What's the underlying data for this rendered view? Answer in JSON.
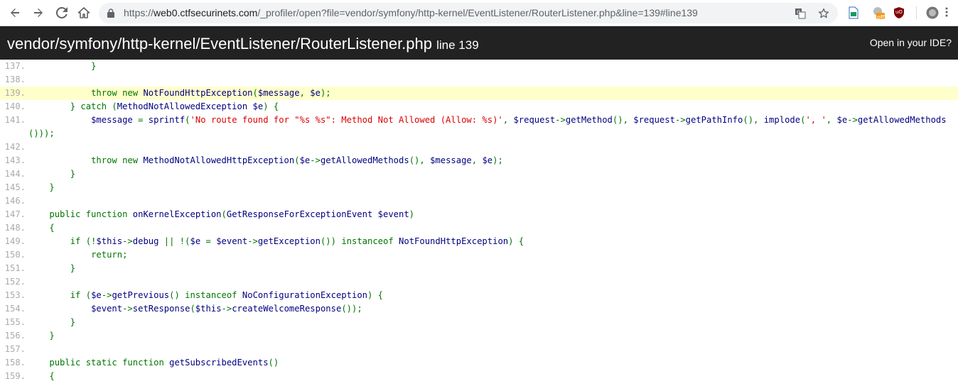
{
  "browser": {
    "url_host": "web0.ctfsecurinets.com",
    "url_scheme": "https://",
    "url_rest": "/_profiler/open?file=vendor/symfony/http-kernel/EventListener/RouterListener.php&line=139#line139",
    "icons": [
      "back-icon",
      "forward-icon",
      "reload-icon",
      "home-icon",
      "lock-icon",
      "translate-icon",
      "star-icon"
    ],
    "extensions": {
      "off_badge": "off",
      "ublock_label": "uO"
    }
  },
  "header": {
    "path": "vendor/symfony/http-kernel/EventListener/RouterListener.php",
    "line_label": "line 139",
    "ide_link": "Open in your IDE?"
  },
  "colors": {
    "highlight": "#ffffcc",
    "keyword": "#007700",
    "string": "#dd0000",
    "default": "#000080"
  },
  "code": {
    "highlight_line": "139.",
    "lines": [
      {
        "num": "137.",
        "tokens": [
          {
            "t": "            }",
            "c": "punct"
          }
        ]
      },
      {
        "num": "138.",
        "tokens": []
      },
      {
        "num": "139.",
        "tokens": [
          {
            "t": "            throw new ",
            "c": "keyword"
          },
          {
            "t": "NotFoundHttpException",
            "c": "default"
          },
          {
            "t": "(",
            "c": "punct"
          },
          {
            "t": "$message",
            "c": "default"
          },
          {
            "t": ", ",
            "c": "punct"
          },
          {
            "t": "$e",
            "c": "default"
          },
          {
            "t": ");",
            "c": "punct"
          }
        ]
      },
      {
        "num": "140.",
        "tokens": [
          {
            "t": "        } catch (",
            "c": "keyword"
          },
          {
            "t": "MethodNotAllowedException $e",
            "c": "default"
          },
          {
            "t": ") {",
            "c": "punct"
          }
        ]
      },
      {
        "num": "141.",
        "wrap": true,
        "tokens": [
          {
            "t": "            ",
            "c": "punct"
          },
          {
            "t": "$message ",
            "c": "default"
          },
          {
            "t": "= ",
            "c": "punct"
          },
          {
            "t": "sprintf",
            "c": "default"
          },
          {
            "t": "(",
            "c": "punct"
          },
          {
            "t": "'No route found for \"%s %s\": Method Not Allowed (Allow: %s)'",
            "c": "string"
          },
          {
            "t": ", ",
            "c": "punct"
          },
          {
            "t": "$request",
            "c": "default"
          },
          {
            "t": "->",
            "c": "punct"
          },
          {
            "t": "getMethod",
            "c": "default"
          },
          {
            "t": "(), ",
            "c": "punct"
          },
          {
            "t": "$request",
            "c": "default"
          },
          {
            "t": "->",
            "c": "punct"
          },
          {
            "t": "getPathInfo",
            "c": "default"
          },
          {
            "t": "(), ",
            "c": "punct"
          },
          {
            "t": "implode",
            "c": "default"
          },
          {
            "t": "(",
            "c": "punct"
          },
          {
            "t": "', '",
            "c": "string"
          },
          {
            "t": ", ",
            "c": "punct"
          },
          {
            "t": "$e",
            "c": "default"
          },
          {
            "t": "->",
            "c": "punct"
          },
          {
            "t": "getAllowedMethods",
            "c": "default"
          },
          {
            "t": "()));",
            "c": "punct"
          }
        ]
      },
      {
        "num": "142.",
        "tokens": []
      },
      {
        "num": "143.",
        "tokens": [
          {
            "t": "            throw new ",
            "c": "keyword"
          },
          {
            "t": "MethodNotAllowedHttpException",
            "c": "default"
          },
          {
            "t": "(",
            "c": "punct"
          },
          {
            "t": "$e",
            "c": "default"
          },
          {
            "t": "->",
            "c": "punct"
          },
          {
            "t": "getAllowedMethods",
            "c": "default"
          },
          {
            "t": "(), ",
            "c": "punct"
          },
          {
            "t": "$message",
            "c": "default"
          },
          {
            "t": ", ",
            "c": "punct"
          },
          {
            "t": "$e",
            "c": "default"
          },
          {
            "t": ");",
            "c": "punct"
          }
        ]
      },
      {
        "num": "144.",
        "tokens": [
          {
            "t": "        }",
            "c": "punct"
          }
        ]
      },
      {
        "num": "145.",
        "tokens": [
          {
            "t": "    }",
            "c": "punct"
          }
        ]
      },
      {
        "num": "146.",
        "tokens": []
      },
      {
        "num": "147.",
        "tokens": [
          {
            "t": "    public function ",
            "c": "keyword"
          },
          {
            "t": "onKernelException",
            "c": "default"
          },
          {
            "t": "(",
            "c": "punct"
          },
          {
            "t": "GetResponseForExceptionEvent $event",
            "c": "default"
          },
          {
            "t": ")",
            "c": "punct"
          }
        ]
      },
      {
        "num": "148.",
        "tokens": [
          {
            "t": "    {",
            "c": "punct"
          }
        ]
      },
      {
        "num": "149.",
        "tokens": [
          {
            "t": "        if (!",
            "c": "keyword"
          },
          {
            "t": "$this",
            "c": "default"
          },
          {
            "t": "->",
            "c": "punct"
          },
          {
            "t": "debug ",
            "c": "default"
          },
          {
            "t": "|| !(",
            "c": "punct"
          },
          {
            "t": "$e ",
            "c": "default"
          },
          {
            "t": "= ",
            "c": "punct"
          },
          {
            "t": "$event",
            "c": "default"
          },
          {
            "t": "->",
            "c": "punct"
          },
          {
            "t": "getException",
            "c": "default"
          },
          {
            "t": "()) instanceof ",
            "c": "punct"
          },
          {
            "t": "NotFoundHttpException",
            "c": "default"
          },
          {
            "t": ") {",
            "c": "punct"
          }
        ]
      },
      {
        "num": "150.",
        "tokens": [
          {
            "t": "            return;",
            "c": "keyword"
          }
        ]
      },
      {
        "num": "151.",
        "tokens": [
          {
            "t": "        }",
            "c": "punct"
          }
        ]
      },
      {
        "num": "152.",
        "tokens": []
      },
      {
        "num": "153.",
        "tokens": [
          {
            "t": "        if (",
            "c": "keyword"
          },
          {
            "t": "$e",
            "c": "default"
          },
          {
            "t": "->",
            "c": "punct"
          },
          {
            "t": "getPrevious",
            "c": "default"
          },
          {
            "t": "() instanceof ",
            "c": "punct"
          },
          {
            "t": "NoConfigurationException",
            "c": "default"
          },
          {
            "t": ") {",
            "c": "punct"
          }
        ]
      },
      {
        "num": "154.",
        "tokens": [
          {
            "t": "            ",
            "c": "punct"
          },
          {
            "t": "$event",
            "c": "default"
          },
          {
            "t": "->",
            "c": "punct"
          },
          {
            "t": "setResponse",
            "c": "default"
          },
          {
            "t": "(",
            "c": "punct"
          },
          {
            "t": "$this",
            "c": "default"
          },
          {
            "t": "->",
            "c": "punct"
          },
          {
            "t": "createWelcomeResponse",
            "c": "default"
          },
          {
            "t": "());",
            "c": "punct"
          }
        ]
      },
      {
        "num": "155.",
        "tokens": [
          {
            "t": "        }",
            "c": "punct"
          }
        ]
      },
      {
        "num": "156.",
        "tokens": [
          {
            "t": "    }",
            "c": "punct"
          }
        ]
      },
      {
        "num": "157.",
        "tokens": []
      },
      {
        "num": "158.",
        "tokens": [
          {
            "t": "    public static function ",
            "c": "keyword"
          },
          {
            "t": "getSubscribedEvents",
            "c": "default"
          },
          {
            "t": "()",
            "c": "punct"
          }
        ]
      },
      {
        "num": "159.",
        "tokens": [
          {
            "t": "    {",
            "c": "punct"
          }
        ]
      }
    ]
  }
}
